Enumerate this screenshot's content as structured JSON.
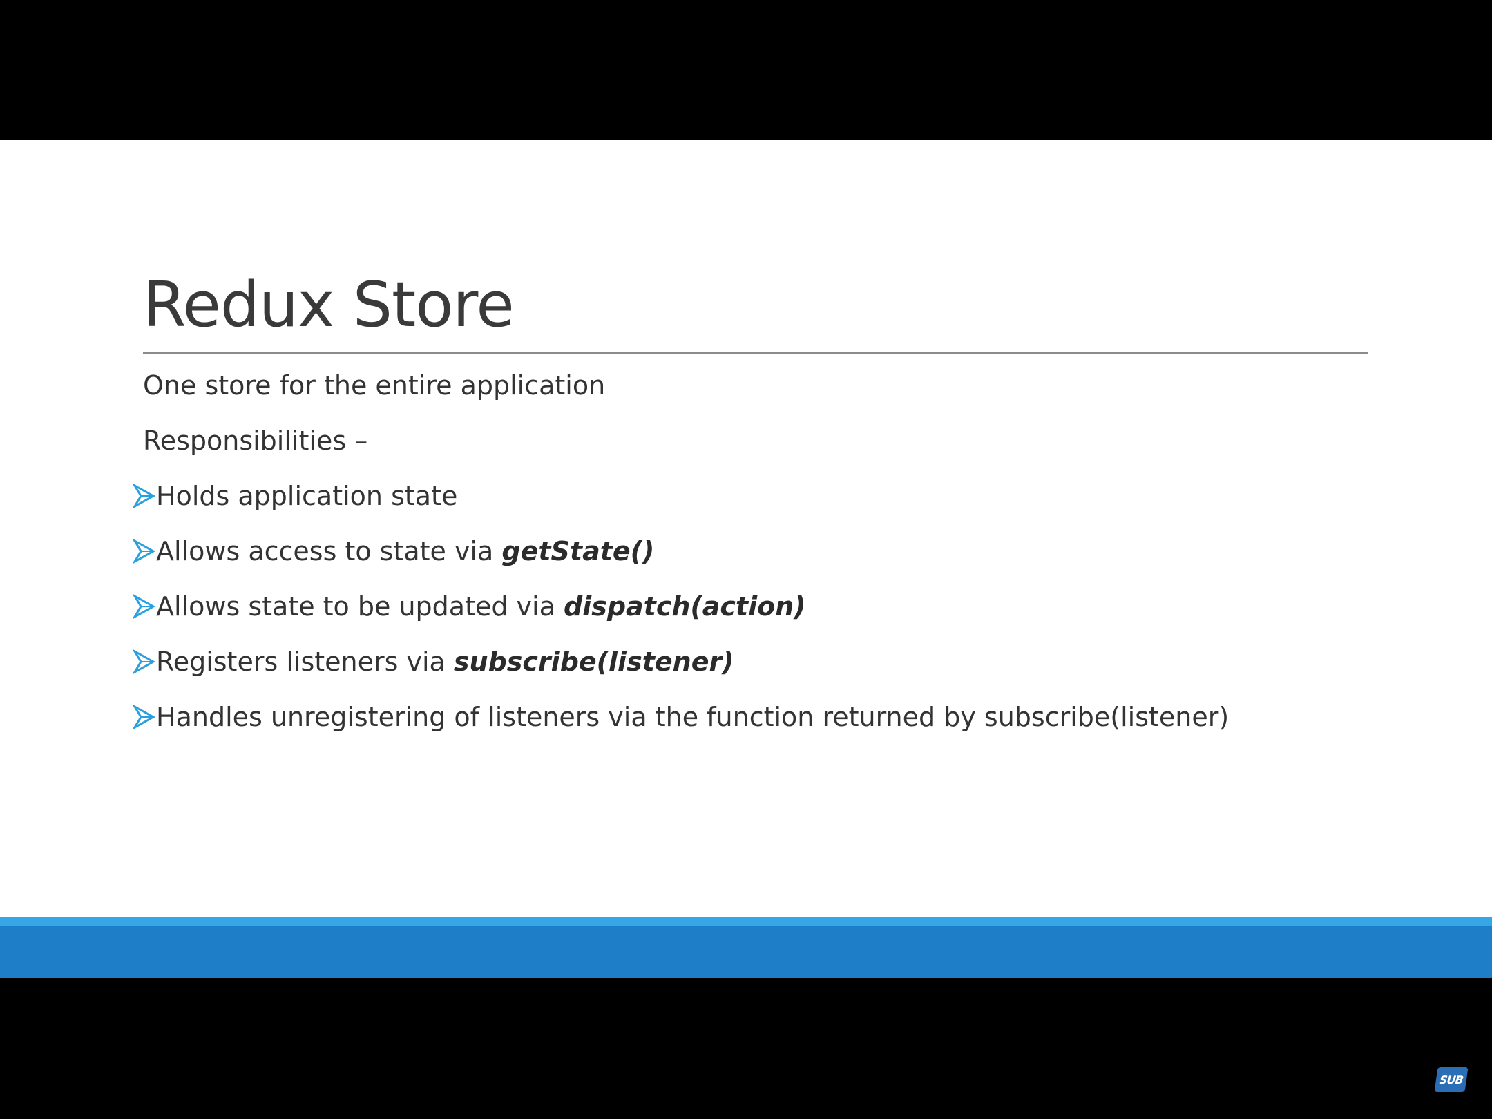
{
  "slide": {
    "title": "Redux Store",
    "paragraphs": [
      "One store for the entire application",
      "Responsibilities –"
    ],
    "bullets": [
      {
        "text": "Holds application state",
        "code": ""
      },
      {
        "text": "Allows access to state via ",
        "code": "getState()"
      },
      {
        "text": "Allows state to be updated via ",
        "code": "dispatch(action)"
      },
      {
        "text": "Registers listeners via ",
        "code": "subscribe(listener)"
      },
      {
        "text": "Handles unregistering of listeners via the function returned by subscribe(listener)",
        "code": ""
      }
    ],
    "bullet_icon": "arrowhead-bullet-icon",
    "accent_color": "#1e7ec8",
    "accent_highlight_color": "#35a7e6",
    "bullet_color": "#2aa0e0"
  },
  "overlay": {
    "badge_label": "SUB"
  }
}
